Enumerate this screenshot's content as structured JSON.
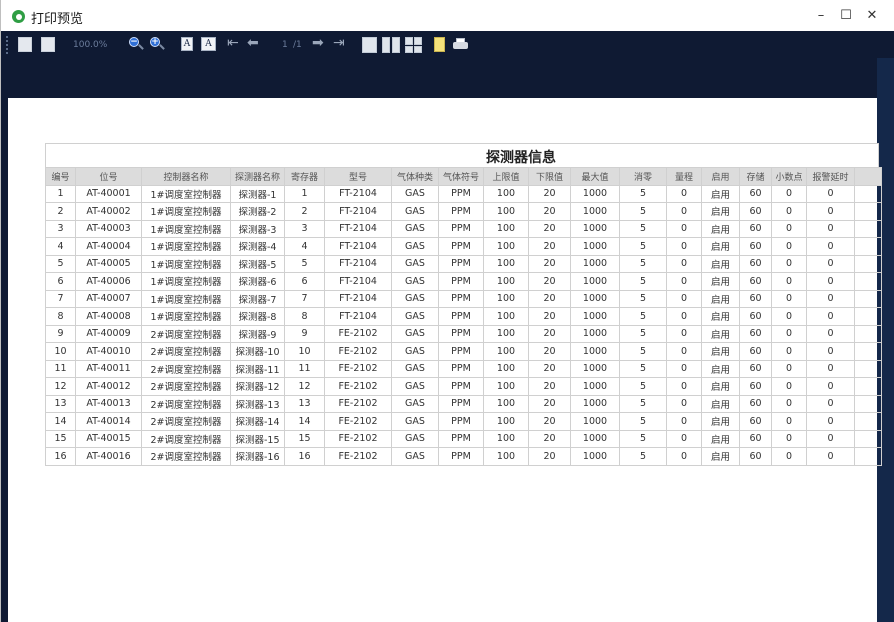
{
  "window": {
    "title": "打印预览",
    "controls": {
      "minimize": "–",
      "maximize": "☐",
      "close": "✕"
    }
  },
  "toolbar": {
    "zoom_level": "100.0%",
    "page_current": "1",
    "page_separator": "/1",
    "icons": [
      "page-width-icon",
      "whole-page-icon",
      "zoom-out-icon",
      "zoom-in-icon",
      "font-icon",
      "font-background-icon",
      "first-page-icon",
      "previous-page-icon",
      "next-page-icon",
      "last-page-icon",
      "single-page-icon",
      "two-pages-icon",
      "four-pages-icon",
      "page-setup-icon",
      "print-icon"
    ]
  },
  "report": {
    "title": "探测器信息",
    "columns": [
      "编号",
      "位号",
      "控制器名称",
      "探测器名称",
      "寄存器",
      "型号",
      "气体种类",
      "气体符号",
      "上限值",
      "下限值",
      "最大值",
      "消零",
      "量程",
      "启用",
      "存储",
      "小数点",
      "报警延时",
      ""
    ],
    "rows": [
      [
        "1",
        "AT-40001",
        "1#调度室控制器",
        "探测器-1",
        "1",
        "FT-2104",
        "GAS",
        "PPM",
        "100",
        "20",
        "1000",
        "5",
        "0",
        "启用",
        "60",
        "0",
        "0",
        ""
      ],
      [
        "2",
        "AT-40002",
        "1#调度室控制器",
        "探测器-2",
        "2",
        "FT-2104",
        "GAS",
        "PPM",
        "100",
        "20",
        "1000",
        "5",
        "0",
        "启用",
        "60",
        "0",
        "0",
        ""
      ],
      [
        "3",
        "AT-40003",
        "1#调度室控制器",
        "探测器-3",
        "3",
        "FT-2104",
        "GAS",
        "PPM",
        "100",
        "20",
        "1000",
        "5",
        "0",
        "启用",
        "60",
        "0",
        "0",
        ""
      ],
      [
        "4",
        "AT-40004",
        "1#调度室控制器",
        "探测器-4",
        "4",
        "FT-2104",
        "GAS",
        "PPM",
        "100",
        "20",
        "1000",
        "5",
        "0",
        "启用",
        "60",
        "0",
        "0",
        ""
      ],
      [
        "5",
        "AT-40005",
        "1#调度室控制器",
        "探测器-5",
        "5",
        "FT-2104",
        "GAS",
        "PPM",
        "100",
        "20",
        "1000",
        "5",
        "0",
        "启用",
        "60",
        "0",
        "0",
        ""
      ],
      [
        "6",
        "AT-40006",
        "1#调度室控制器",
        "探测器-6",
        "6",
        "FT-2104",
        "GAS",
        "PPM",
        "100",
        "20",
        "1000",
        "5",
        "0",
        "启用",
        "60",
        "0",
        "0",
        ""
      ],
      [
        "7",
        "AT-40007",
        "1#调度室控制器",
        "探测器-7",
        "7",
        "FT-2104",
        "GAS",
        "PPM",
        "100",
        "20",
        "1000",
        "5",
        "0",
        "启用",
        "60",
        "0",
        "0",
        ""
      ],
      [
        "8",
        "AT-40008",
        "1#调度室控制器",
        "探测器-8",
        "8",
        "FT-2104",
        "GAS",
        "PPM",
        "100",
        "20",
        "1000",
        "5",
        "0",
        "启用",
        "60",
        "0",
        "0",
        ""
      ],
      [
        "9",
        "AT-40009",
        "2#调度室控制器",
        "探测器-9",
        "9",
        "FE-2102",
        "GAS",
        "PPM",
        "100",
        "20",
        "1000",
        "5",
        "0",
        "启用",
        "60",
        "0",
        "0",
        ""
      ],
      [
        "10",
        "AT-40010",
        "2#调度室控制器",
        "探测器-10",
        "10",
        "FE-2102",
        "GAS",
        "PPM",
        "100",
        "20",
        "1000",
        "5",
        "0",
        "启用",
        "60",
        "0",
        "0",
        ""
      ],
      [
        "11",
        "AT-40011",
        "2#调度室控制器",
        "探测器-11",
        "11",
        "FE-2102",
        "GAS",
        "PPM",
        "100",
        "20",
        "1000",
        "5",
        "0",
        "启用",
        "60",
        "0",
        "0",
        ""
      ],
      [
        "12",
        "AT-40012",
        "2#调度室控制器",
        "探测器-12",
        "12",
        "FE-2102",
        "GAS",
        "PPM",
        "100",
        "20",
        "1000",
        "5",
        "0",
        "启用",
        "60",
        "0",
        "0",
        ""
      ],
      [
        "13",
        "AT-40013",
        "2#调度室控制器",
        "探测器-13",
        "13",
        "FE-2102",
        "GAS",
        "PPM",
        "100",
        "20",
        "1000",
        "5",
        "0",
        "启用",
        "60",
        "0",
        "0",
        ""
      ],
      [
        "14",
        "AT-40014",
        "2#调度室控制器",
        "探测器-14",
        "14",
        "FE-2102",
        "GAS",
        "PPM",
        "100",
        "20",
        "1000",
        "5",
        "0",
        "启用",
        "60",
        "0",
        "0",
        ""
      ],
      [
        "15",
        "AT-40015",
        "2#调度室控制器",
        "探测器-15",
        "15",
        "FE-2102",
        "GAS",
        "PPM",
        "100",
        "20",
        "1000",
        "5",
        "0",
        "启用",
        "60",
        "0",
        "0",
        ""
      ],
      [
        "16",
        "AT-40016",
        "2#调度室控制器",
        "探测器-16",
        "16",
        "FE-2102",
        "GAS",
        "PPM",
        "100",
        "20",
        "1000",
        "5",
        "0",
        "启用",
        "60",
        "0",
        "0",
        ""
      ]
    ]
  },
  "colors": {
    "toolbar_bg": "#0f1a33",
    "header_bg": "#dcdcdc",
    "app_icon": "#2f9e44"
  }
}
